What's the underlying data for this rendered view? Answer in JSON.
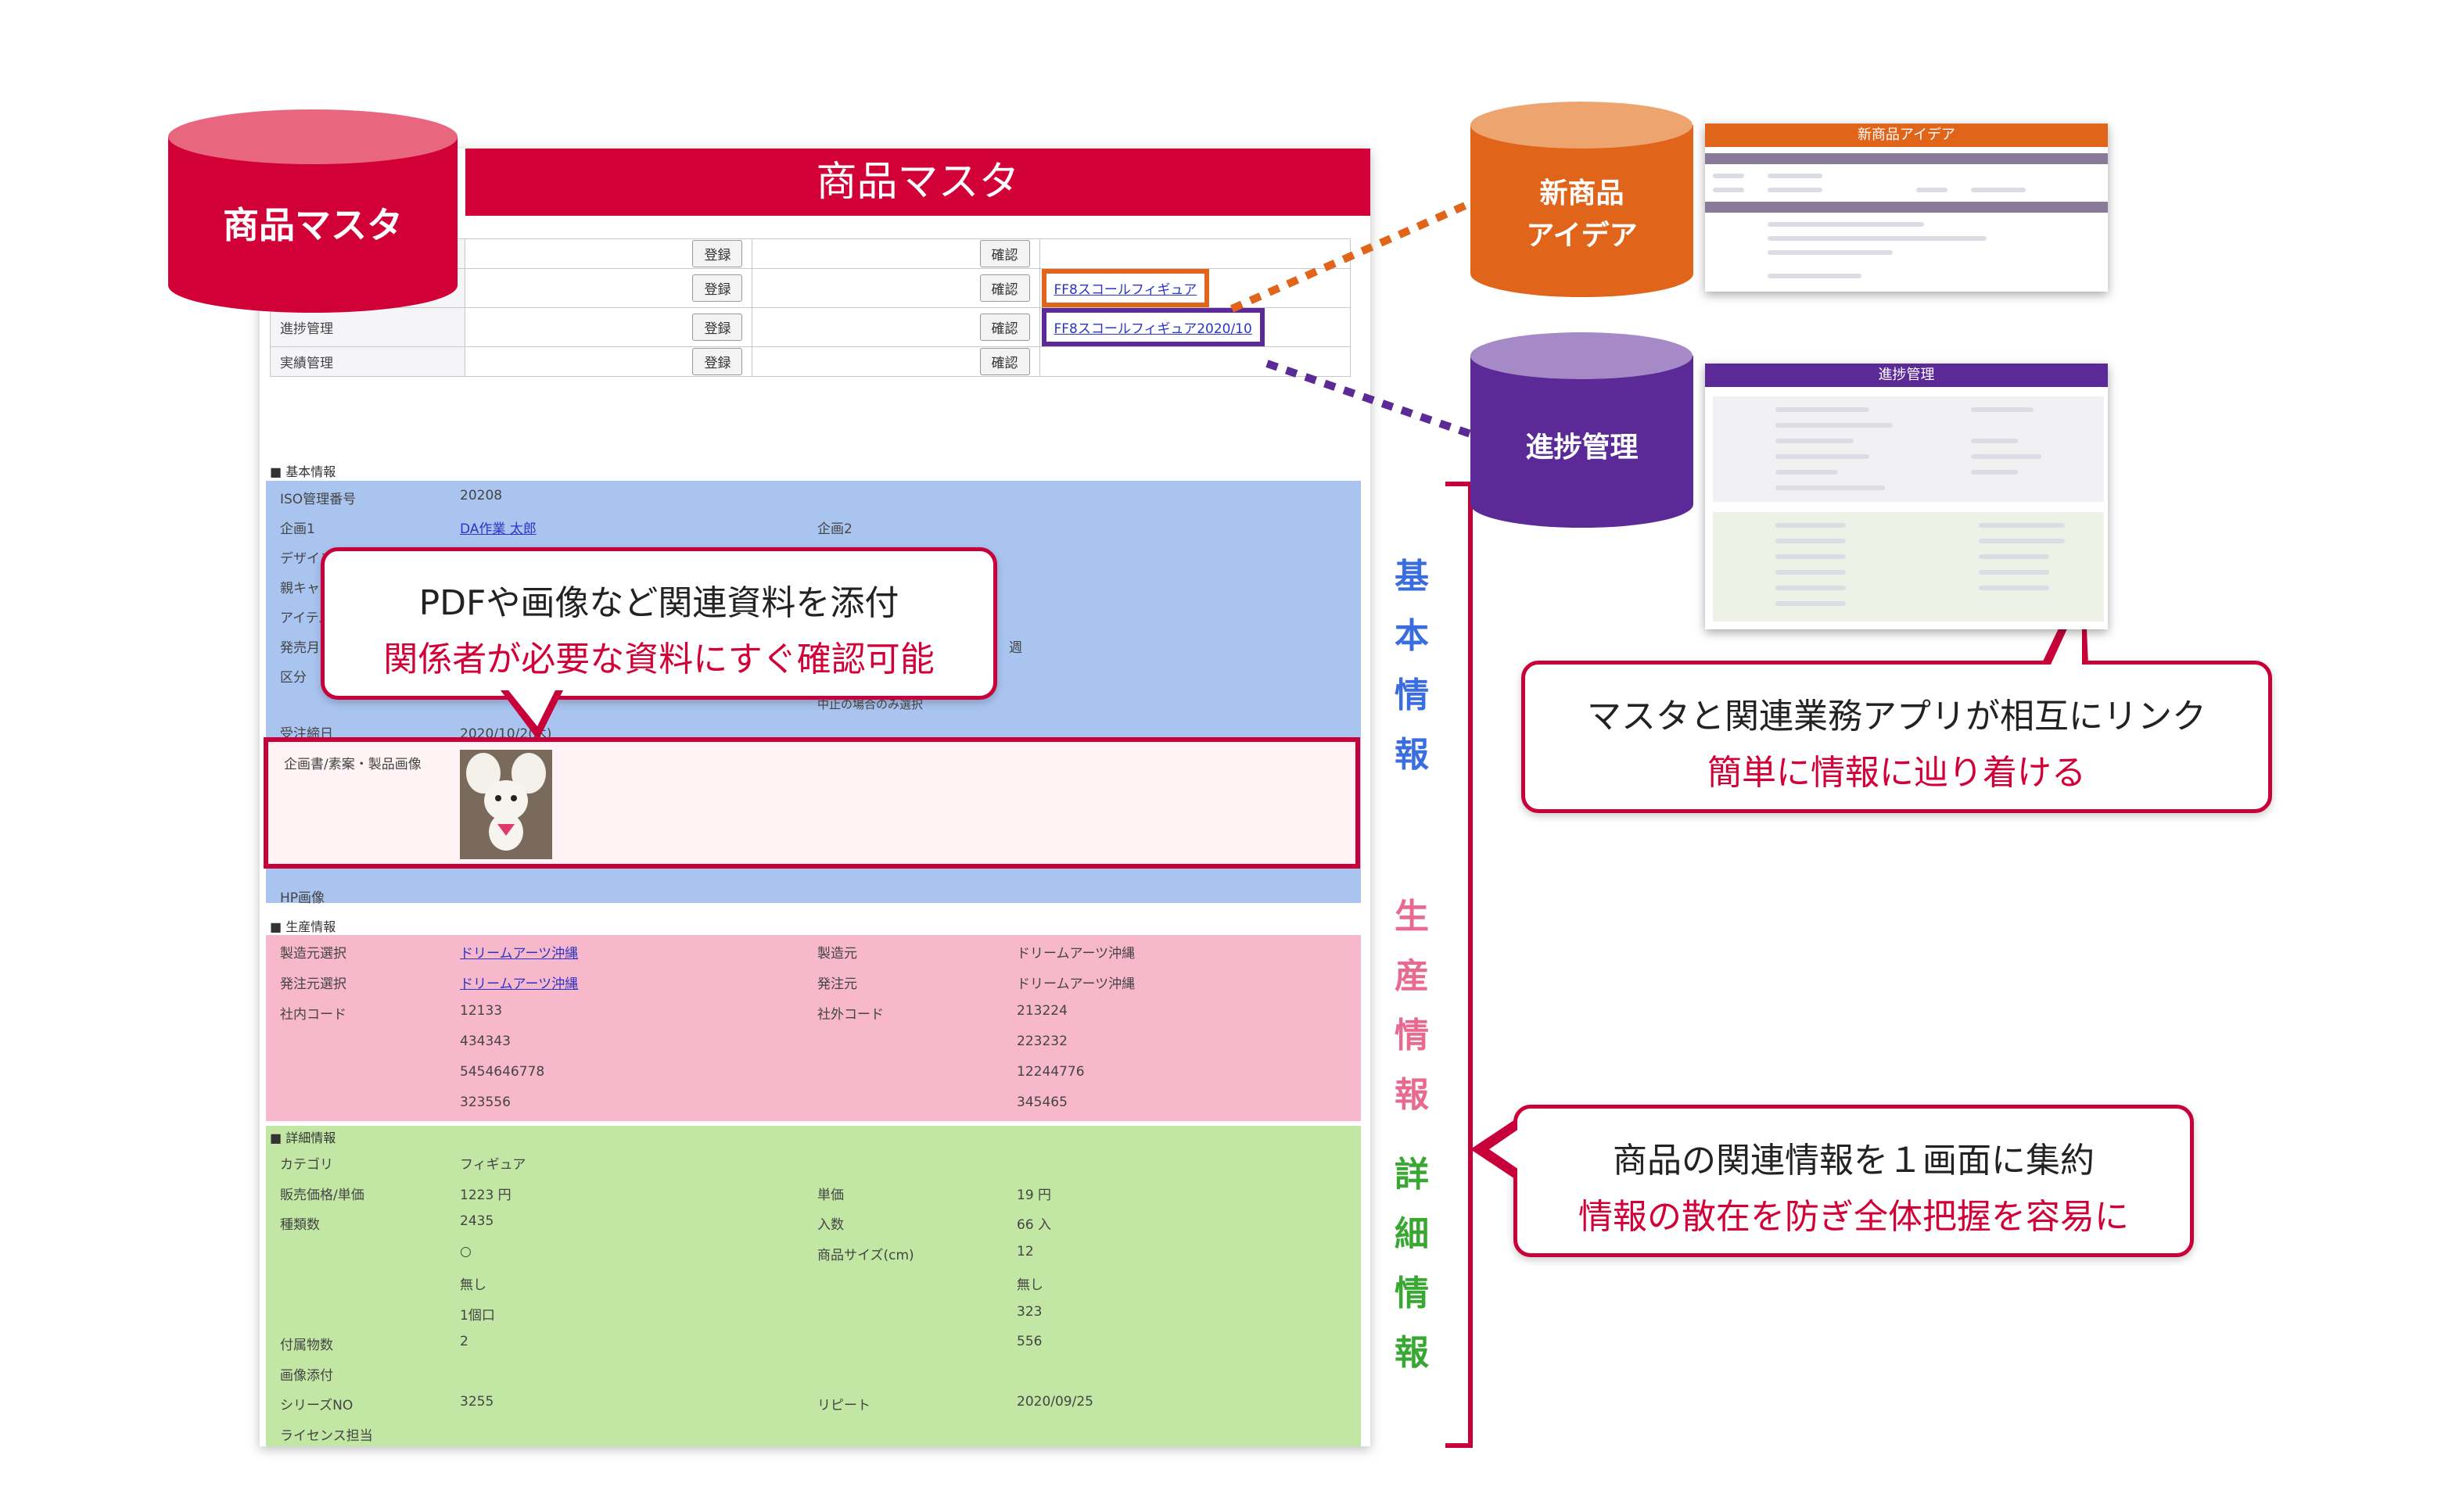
{
  "master": {
    "cylinder_label": "商品マスタ",
    "title": "商品マスタ",
    "buttons": {
      "register": "登録",
      "confirm": "確認"
    },
    "link_rows": [
      {
        "label": "",
        "link": ""
      },
      {
        "label": "",
        "link": "FF8スコールフィギュア"
      },
      {
        "label": "進捗管理",
        "link": "FF8スコールフィギュア2020/10"
      },
      {
        "label": "実績管理",
        "link": ""
      }
    ],
    "basic": {
      "section": "■ 基本情報",
      "iso_label": "ISO管理番号",
      "iso_value": "20208",
      "plan1_label": "企画1",
      "plan1_value": "DA作業 太郎",
      "plan2_label": "企画2",
      "design_label": "デザイン",
      "parent_label": "親キャラ",
      "item_label": "アイテム",
      "release_label": "発売月",
      "week": "週",
      "category_label": "区分",
      "stop_note": "中止の場合のみ選択",
      "order_label": "受注締日",
      "order_value": "2020/10/2(木)",
      "image_label": "企画書/素案・製品画像",
      "hp_label": "HP画像"
    },
    "production": {
      "section": "■ 生産情報",
      "rows": [
        {
          "l1": "製造元選択",
          "v1": "ドリームアーツ沖縄",
          "l2": "製造元",
          "v2": "ドリームアーツ沖縄"
        },
        {
          "l1": "発注元選択",
          "v1": "ドリームアーツ沖縄",
          "l2": "発注元",
          "v2": "ドリームアーツ沖縄"
        },
        {
          "l1": "社内コード",
          "v1": "12133",
          "l2": "社外コード",
          "v2": "213224"
        },
        {
          "l1": "",
          "v1": "434343",
          "l2": "",
          "v2": "223232"
        },
        {
          "l1": "",
          "v1": "5454646778",
          "l2": "",
          "v2": "12244776"
        },
        {
          "l1": "",
          "v1": "323556",
          "l2": "",
          "v2": "345465"
        }
      ]
    },
    "detail": {
      "section": "■ 詳細情報",
      "rows": [
        {
          "l1": "カテゴリ",
          "v1": "フィギュア",
          "l2": "",
          "v2": ""
        },
        {
          "l1": "販売価格/単価",
          "v1": "1223 円",
          "l2": "単価",
          "v2": "19 円"
        },
        {
          "l1": "種類数",
          "v1": "2435",
          "l2": "入数",
          "v2": "66 入"
        },
        {
          "l1": "",
          "v1": "○",
          "l2": "商品サイズ(cm)",
          "v2": "12"
        },
        {
          "l1": "",
          "v1": "無し",
          "l2": "",
          "v2": "無し"
        },
        {
          "l1": "",
          "v1": "1個口",
          "l2": "",
          "v2": "323"
        },
        {
          "l1": "付属物数",
          "v1": "2",
          "l2": "",
          "v2": "556"
        },
        {
          "l1": "画像添付",
          "v1": "",
          "l2": "",
          "v2": ""
        },
        {
          "l1": "シリーズNO",
          "v1": "3255",
          "l2": "リピート",
          "v2": "2020/09/25"
        },
        {
          "l1": "ライセンス担当",
          "v1": "",
          "l2": "",
          "v2": ""
        }
      ]
    }
  },
  "side_labels": {
    "basic": [
      "基",
      "本",
      "情",
      "報"
    ],
    "production": [
      "生",
      "産",
      "情",
      "報"
    ],
    "detail": [
      "詳",
      "細",
      "情",
      "報"
    ]
  },
  "callouts": {
    "attach": {
      "line1": "PDFや画像など関連資料を添付",
      "line2": "関係者が必要な資料にすぐ確認可能"
    },
    "link": {
      "line1": "マスタと関連業務アプリが相互にリンク",
      "line2": "簡単に情報に辿り着ける"
    },
    "consolidate": {
      "line1": "商品の関連情報を１画面に集約",
      "line2": "情報の散在を防ぎ全体把握を容易に"
    }
  },
  "apps": {
    "idea": {
      "cylinder_line1": "新商品",
      "cylinder_line2": "アイデア",
      "screen_title": "新商品アイデア"
    },
    "progress": {
      "cylinder_label": "進捗管理",
      "screen_title": "進捗管理"
    }
  },
  "colors": {
    "red": "#d10037",
    "orange": "#e0641a",
    "purple": "#5b2a97",
    "blue_band": "#aac4f0",
    "pink_band": "#f8b8cc",
    "green_band": "#c2e6a4"
  }
}
